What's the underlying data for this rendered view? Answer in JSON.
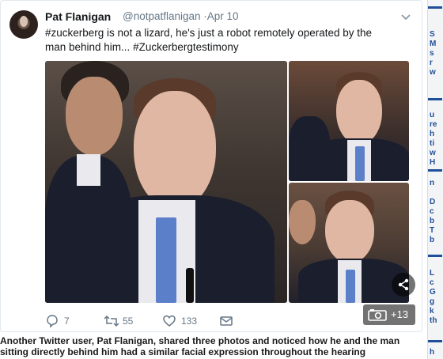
{
  "tweet": {
    "author_name": "Pat Flanigan",
    "handle_date": "@notpatflanigan ·Apr 10",
    "text": "#zuckerberg is not a lizard, he's just a robot remotely operated by the man behind him... #Zuckerbergtestimony",
    "more_photos": "+13",
    "actions": {
      "replies": "7",
      "retweets": "55",
      "likes": "133"
    },
    "icons": [
      "chevron-down-icon",
      "share-icon",
      "camera-icon",
      "reply-icon",
      "retweet-icon",
      "heart-icon",
      "envelope-icon"
    ]
  },
  "caption": "Another Twitter user, Pat Flanigan, shared three photos and noticed how he and the man sitting directly behind him had a similar facial expression throughout the hearing",
  "sidebar": {
    "letters": [
      "S",
      "M",
      "s",
      "r",
      "w",
      "u",
      "re",
      "h",
      "ti",
      "w",
      "H",
      "n",
      "D",
      "c",
      "b",
      "T",
      "b",
      "L",
      "c",
      "G",
      "g",
      "k",
      "th",
      "h"
    ]
  },
  "colors": {
    "link": "#1da1f2",
    "muted": "#657786",
    "sidebar_accent": "#1f4e9a"
  }
}
